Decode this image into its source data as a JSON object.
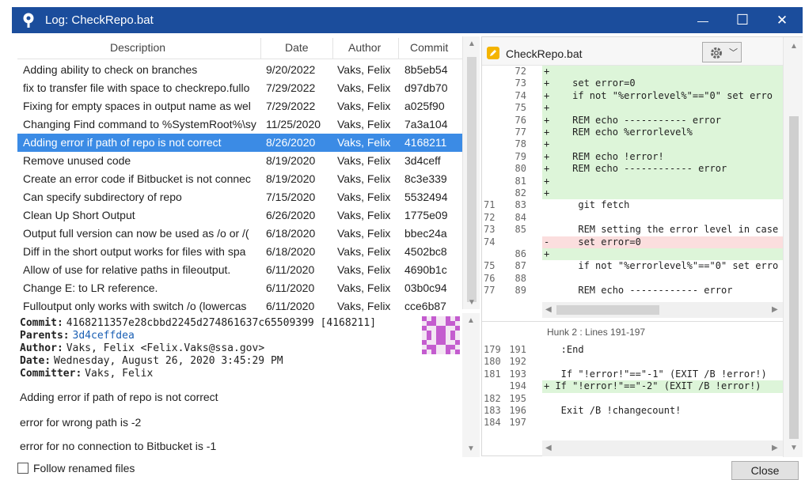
{
  "window": {
    "title": "Log: CheckRepo.bat",
    "minimize": "—",
    "maximize": "☐",
    "close": "✕"
  },
  "log": {
    "columns": [
      "Description",
      "Date",
      "Author",
      "Commit"
    ],
    "rows": [
      {
        "description": "Adding ability to check on branches",
        "date": "9/20/2022",
        "author": "Vaks, Felix",
        "commit": "8b5eb54"
      },
      {
        "description": "fix to transfer file with space to checkrepo.fullo",
        "date": "7/29/2022",
        "author": "Vaks, Felix",
        "commit": "d97db70"
      },
      {
        "description": "Fixing for empty spaces in output name as wel",
        "date": "7/29/2022",
        "author": "Vaks, Felix",
        "commit": "a025f90"
      },
      {
        "description": "Changing Find command to %SystemRoot%\\sy",
        "date": "11/25/2020",
        "author": "Vaks, Felix",
        "commit": "7a3a104"
      },
      {
        "description": "Adding error if path of repo is not correct",
        "date": "8/26/2020",
        "author": "Vaks, Felix",
        "commit": "4168211",
        "selected": true
      },
      {
        "description": "Remove unused code",
        "date": "8/19/2020",
        "author": "Vaks, Felix",
        "commit": "3d4ceff"
      },
      {
        "description": "Create an error code if Bitbucket is not connec",
        "date": "8/19/2020",
        "author": "Vaks, Felix",
        "commit": "8c3e339"
      },
      {
        "description": "Can specify subdirectory of repo",
        "date": "7/15/2020",
        "author": "Vaks, Felix",
        "commit": "5532494"
      },
      {
        "description": "Clean Up Short Output",
        "date": "6/26/2020",
        "author": "Vaks, Felix",
        "commit": "1775e09"
      },
      {
        "description": "Output full version can now be used as /o or /(",
        "date": "6/18/2020",
        "author": "Vaks, Felix",
        "commit": "bbec24a"
      },
      {
        "description": "Diff in the short output works for files with spa",
        "date": "6/18/2020",
        "author": "Vaks, Felix",
        "commit": "4502bc8"
      },
      {
        "description": "Allow of use for relative paths in fileoutput.",
        "date": "6/11/2020",
        "author": "Vaks, Felix",
        "commit": "4690b1c"
      },
      {
        "description": "Change E: to LR reference.",
        "date": "6/11/2020",
        "author": "Vaks, Felix",
        "commit": "03b0c94"
      },
      {
        "description": "Fulloutput only works with switch /o (lowercas",
        "date": "6/11/2020",
        "author": "Vaks, Felix",
        "commit": "cce6b87"
      }
    ]
  },
  "details": {
    "commit_label": "Commit:",
    "commit_value": "4168211357e28cbbd2245d274861637c65509399 [4168211]",
    "parents_label": "Parents:",
    "parents_value": "3d4ceffdea",
    "author_label": "Author:",
    "author_value": "Vaks, Felix <Felix.Vaks@ssa.gov>",
    "date_label": "Date:",
    "date_value": "Wednesday, August 26, 2020 3:45:29 PM",
    "committer_label": "Committer:",
    "committer_value": "Vaks, Felix",
    "message_lines": [
      "Adding error if path of repo is not correct",
      "error for wrong path is -2",
      "error for no connection to Bitbucket is -1"
    ]
  },
  "follow_renamed": "Follow renamed files",
  "close_button": "Close",
  "file": {
    "name": "CheckRepo.bat",
    "hunk2_title": "Hunk 2 : Lines 191-197"
  },
  "diff1": [
    {
      "o": "",
      "n": "72",
      "t": "+",
      "code": "+"
    },
    {
      "o": "",
      "n": "73",
      "t": "+",
      "code": "+    set error=0"
    },
    {
      "o": "",
      "n": "74",
      "t": "+",
      "code": "+    if not \"%errorlevel%\"==\"0\" set erro"
    },
    {
      "o": "",
      "n": "75",
      "t": "+",
      "code": "+"
    },
    {
      "o": "",
      "n": "76",
      "t": "+",
      "code": "+    REM echo ----------- error"
    },
    {
      "o": "",
      "n": "77",
      "t": "+",
      "code": "+    REM echo %errorlevel%"
    },
    {
      "o": "",
      "n": "78",
      "t": "+",
      "code": "+"
    },
    {
      "o": "",
      "n": "79",
      "t": "+",
      "code": "+    REM echo !error!"
    },
    {
      "o": "",
      "n": "80",
      "t": "+",
      "code": "+    REM echo ------------ error"
    },
    {
      "o": "",
      "n": "81",
      "t": "+",
      "code": "+"
    },
    {
      "o": "",
      "n": "82",
      "t": "+",
      "code": "+"
    },
    {
      "o": "71",
      "n": "83",
      "t": " ",
      "code": "      git fetch"
    },
    {
      "o": "72",
      "n": "84",
      "t": " ",
      "code": ""
    },
    {
      "o": "73",
      "n": "85",
      "t": " ",
      "code": "      REM setting the error level in case"
    },
    {
      "o": "74",
      "n": "",
      "t": "-",
      "code": "-     set error=0"
    },
    {
      "o": "",
      "n": "86",
      "t": "+",
      "code": "+"
    },
    {
      "o": "75",
      "n": "87",
      "t": " ",
      "code": "      if not \"%errorlevel%\"==\"0\" set erro"
    },
    {
      "o": "76",
      "n": "88",
      "t": " ",
      "code": ""
    },
    {
      "o": "77",
      "n": "89",
      "t": " ",
      "code": "      REM echo ------------ error"
    }
  ],
  "diff2": [
    {
      "o": "179",
      "n": "191",
      "t": " ",
      "code": "   :End"
    },
    {
      "o": "180",
      "n": "192",
      "t": " ",
      "code": ""
    },
    {
      "o": "181",
      "n": "193",
      "t": " ",
      "code": "   If \"!error!\"==\"-1\" (EXIT /B !error!)"
    },
    {
      "o": "",
      "n": "194",
      "t": "+",
      "code": "+ If \"!error!\"==\"-2\" (EXIT /B !error!)"
    },
    {
      "o": "182",
      "n": "195",
      "t": " ",
      "code": ""
    },
    {
      "o": "183",
      "n": "196",
      "t": " ",
      "code": "   Exit /B !changecount!"
    },
    {
      "o": "184",
      "n": "197",
      "t": " ",
      "code": ""
    }
  ]
}
